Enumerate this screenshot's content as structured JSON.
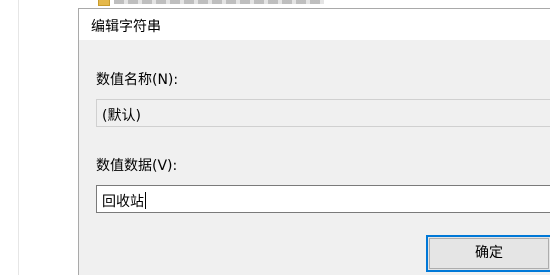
{
  "dialog": {
    "title": "编辑字符串",
    "value_name": {
      "label": "数值名称(N):",
      "value": "(默认)"
    },
    "value_data": {
      "label": "数值数据(V):",
      "value": "回收站"
    },
    "ok_button": "确定"
  },
  "colors": {
    "accent": "#0078d7",
    "dialog_bg": "#f0f0f0"
  }
}
